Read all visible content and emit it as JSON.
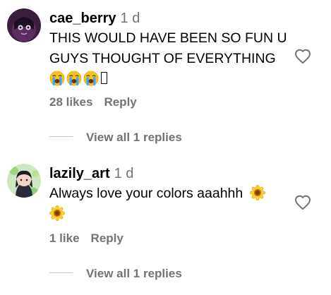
{
  "comments": [
    {
      "username": "cae_berry",
      "time": "1 d",
      "text_line1": "THIS WOULD HAVE BEEN SO FUN U",
      "text_line2": "GUYS THOUGHT OF EVERYTHING",
      "emojis": [
        "loudly-crying-face",
        "loudly-crying-face",
        "loudly-crying-face",
        "missing-glyph"
      ],
      "likes": "28 likes",
      "reply_label": "Reply",
      "view_replies": "View all 1 replies"
    },
    {
      "username": "lazily_art",
      "time": "1 d",
      "text_line1": "Always love your colors aaahhh",
      "emojis": [
        "sunflower",
        "sunflower"
      ],
      "likes": "1 like",
      "reply_label": "Reply",
      "view_replies": "View all 1 replies"
    }
  ],
  "colors": {
    "primary_text": "#000000",
    "secondary_text": "#737373",
    "divider": "#c7c7c7"
  },
  "icons": [
    "heart-outline-icon",
    "loudly-crying-face-emoji",
    "sunflower-emoji"
  ]
}
